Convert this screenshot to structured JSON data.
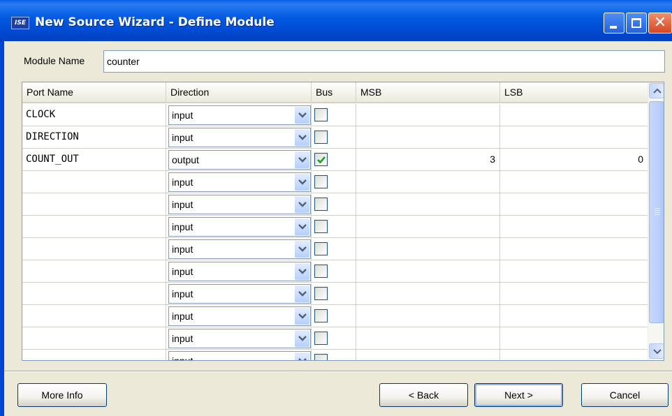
{
  "window": {
    "title": "New Source Wizard - Define Module",
    "app_icon_text": "ISE"
  },
  "module": {
    "label": "Module Name",
    "value": "counter"
  },
  "table": {
    "headers": [
      "Port Name",
      "Direction",
      "Bus",
      "MSB",
      "LSB"
    ],
    "rows": [
      {
        "name": "CLOCK",
        "direction": "input",
        "bus": false,
        "msb": "",
        "lsb": ""
      },
      {
        "name": "DIRECTION",
        "direction": "input",
        "bus": false,
        "msb": "",
        "lsb": ""
      },
      {
        "name": "COUNT_OUT",
        "direction": "output",
        "bus": true,
        "msb": "3",
        "lsb": "0"
      },
      {
        "name": "",
        "direction": "input",
        "bus": false,
        "msb": "",
        "lsb": ""
      },
      {
        "name": "",
        "direction": "input",
        "bus": false,
        "msb": "",
        "lsb": ""
      },
      {
        "name": "",
        "direction": "input",
        "bus": false,
        "msb": "",
        "lsb": ""
      },
      {
        "name": "",
        "direction": "input",
        "bus": false,
        "msb": "",
        "lsb": ""
      },
      {
        "name": "",
        "direction": "input",
        "bus": false,
        "msb": "",
        "lsb": ""
      },
      {
        "name": "",
        "direction": "input",
        "bus": false,
        "msb": "",
        "lsb": ""
      },
      {
        "name": "",
        "direction": "input",
        "bus": false,
        "msb": "",
        "lsb": ""
      },
      {
        "name": "",
        "direction": "input",
        "bus": false,
        "msb": "",
        "lsb": ""
      },
      {
        "name": "",
        "direction": "input",
        "bus": false,
        "msb": "",
        "lsb": ""
      }
    ]
  },
  "buttons": {
    "more_info": "More Info",
    "back": "< Back",
    "next": "Next >",
    "cancel": "Cancel"
  },
  "colors": {
    "title_bar": "#0054e3",
    "dialog_bg": "#ece9d8",
    "check_mark": "#21a121"
  }
}
